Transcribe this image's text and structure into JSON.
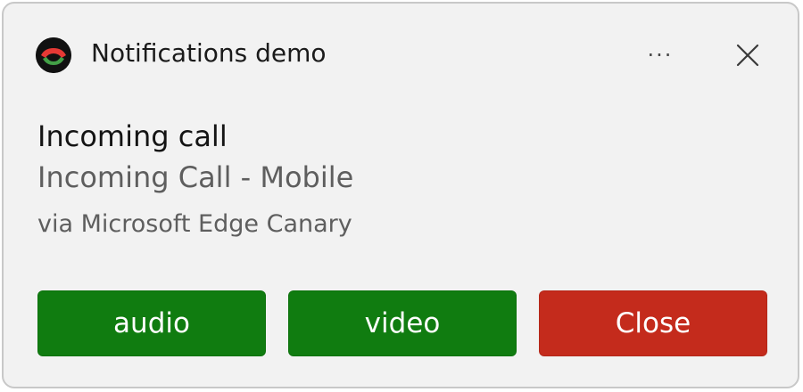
{
  "app": {
    "name": "Notifications demo",
    "icon": "phone-handset-icon"
  },
  "header": {
    "more_label": "···",
    "close_icon": "close-icon"
  },
  "notification": {
    "title": "Incoming call",
    "body": "Incoming Call - Mobile",
    "attribution": "via Microsoft Edge Canary"
  },
  "actions": [
    {
      "label": "audio",
      "color": "#107c10"
    },
    {
      "label": "video",
      "color": "#107c10"
    },
    {
      "label": "Close",
      "color": "#c42b1c"
    }
  ],
  "colors": {
    "toast_background": "#f2f2f2",
    "accept_green": "#107c10",
    "decline_red": "#c42b1c"
  }
}
